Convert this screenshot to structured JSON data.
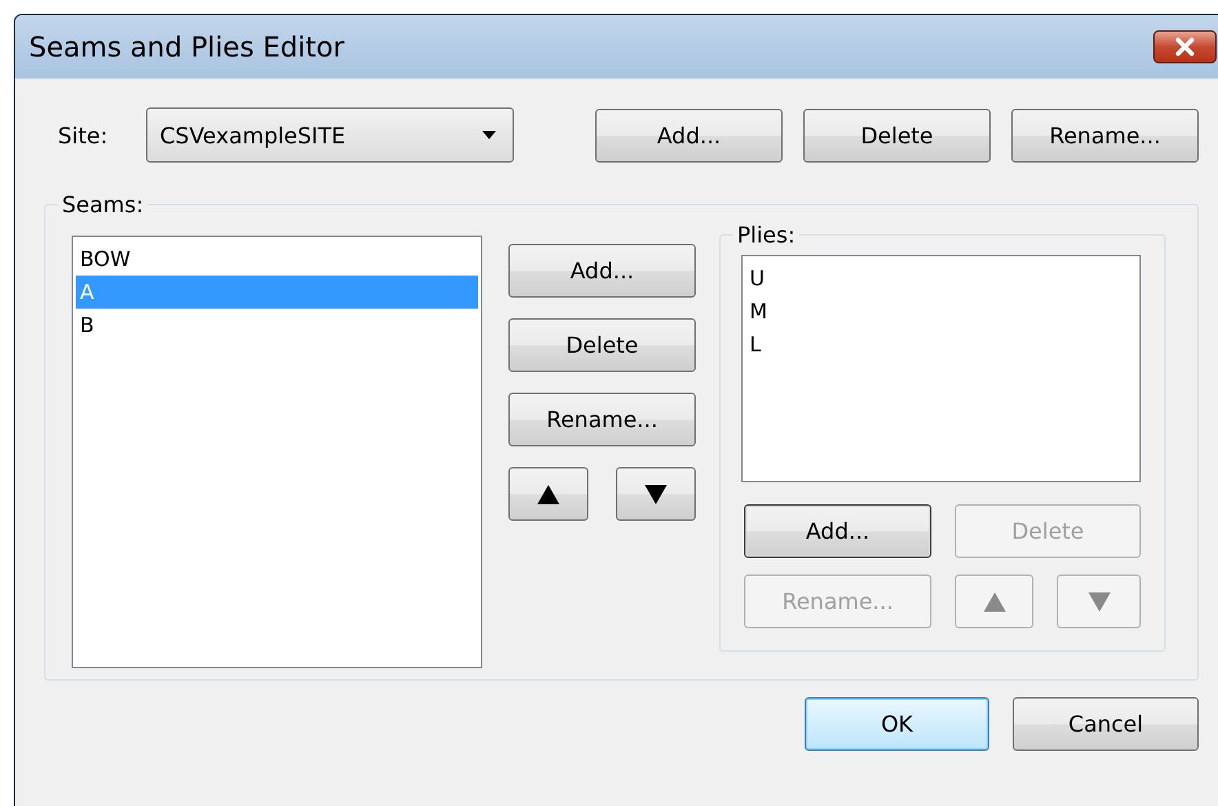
{
  "window": {
    "title": "Seams and Plies Editor"
  },
  "site": {
    "label": "Site:",
    "value": "CSVexampleSITE"
  },
  "site_buttons": [
    {
      "label": "Add...",
      "disabled": false
    },
    {
      "label": "Delete",
      "disabled": false
    },
    {
      "label": "Rename...",
      "disabled": false
    }
  ],
  "seams": {
    "label": "Seams:",
    "items": [
      {
        "text": "BOW",
        "selected": false
      },
      {
        "text": "A",
        "selected": true
      },
      {
        "text": "B",
        "selected": false
      }
    ],
    "buttons": [
      {
        "kind": "text",
        "label": "Add...",
        "disabled": false
      },
      {
        "kind": "text",
        "label": "Delete",
        "disabled": false
      },
      {
        "kind": "text",
        "label": "Rename...",
        "disabled": false
      },
      {
        "kind": "up",
        "disabled": false
      },
      {
        "kind": "down",
        "disabled": false
      }
    ]
  },
  "plies": {
    "label": "Plies:",
    "items": [
      {
        "text": "U",
        "selected": false
      },
      {
        "text": "M",
        "selected": false
      },
      {
        "text": "L",
        "selected": false
      }
    ],
    "buttons": [
      {
        "kind": "text",
        "label": "Add...",
        "disabled": false,
        "focused": true
      },
      {
        "kind": "text",
        "label": "Delete",
        "disabled": true,
        "focused": false
      },
      {
        "kind": "text",
        "label": "Rename...",
        "disabled": true,
        "focused": false
      },
      {
        "kind": "up",
        "disabled": true,
        "focused": false
      },
      {
        "kind": "down",
        "disabled": true,
        "focused": false
      }
    ]
  },
  "dialog_buttons": [
    {
      "label": "OK",
      "default": true
    },
    {
      "label": "Cancel",
      "default": false
    }
  ]
}
